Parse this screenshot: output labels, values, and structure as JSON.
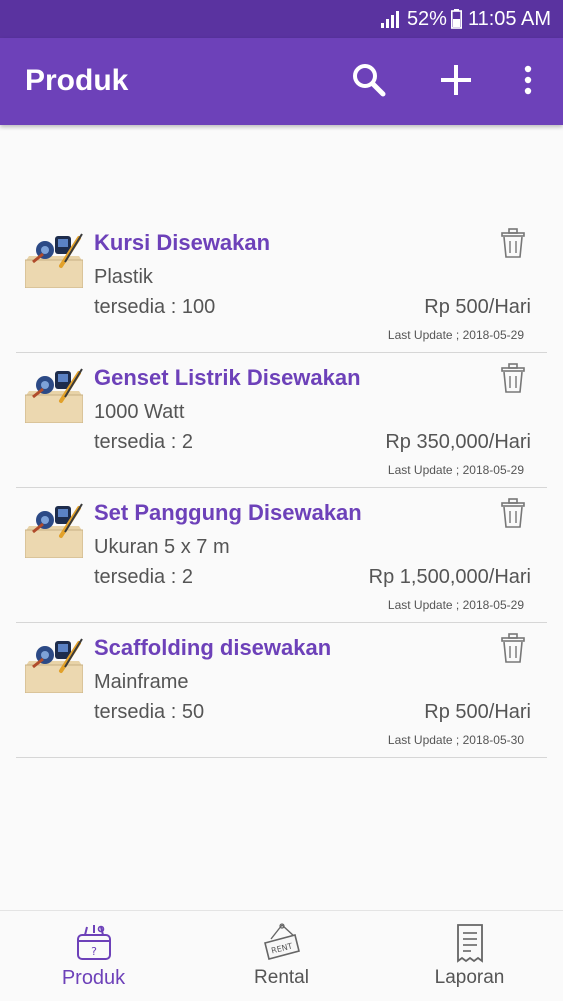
{
  "status_bar": {
    "battery": "52%",
    "time": "11:05 AM"
  },
  "app_bar": {
    "title": "Produk"
  },
  "products": [
    {
      "name": "Kursi Disewakan",
      "description": "Plastik",
      "availability": "tersedia : 100",
      "price": "Rp 500/Hari",
      "last_update": "Last Update ; 2018-05-29"
    },
    {
      "name": "Genset Listrik Disewakan",
      "description": "1000 Watt",
      "availability": "tersedia : 2",
      "price": "Rp 350,000/Hari",
      "last_update": "Last Update ; 2018-05-29"
    },
    {
      "name": "Set Panggung Disewakan",
      "description": "Ukuran 5 x 7 m",
      "availability": "tersedia : 2",
      "price": "Rp 1,500,000/Hari",
      "last_update": "Last Update ; 2018-05-29"
    },
    {
      "name": "Scaffolding disewakan",
      "description": "Mainframe",
      "availability": "tersedia : 50",
      "price": "Rp 500/Hari",
      "last_update": "Last Update ; 2018-05-30"
    }
  ],
  "bottom_nav": {
    "items": [
      {
        "label": "Produk",
        "icon": "basket-icon",
        "active": true
      },
      {
        "label": "Rental",
        "icon": "rent-sign-icon",
        "active": false
      },
      {
        "label": "Laporan",
        "icon": "receipt-icon",
        "active": false
      }
    ]
  },
  "colors": {
    "primary": "#6d41b9",
    "status_bar": "#5a33a0",
    "text_secondary": "#555555"
  }
}
